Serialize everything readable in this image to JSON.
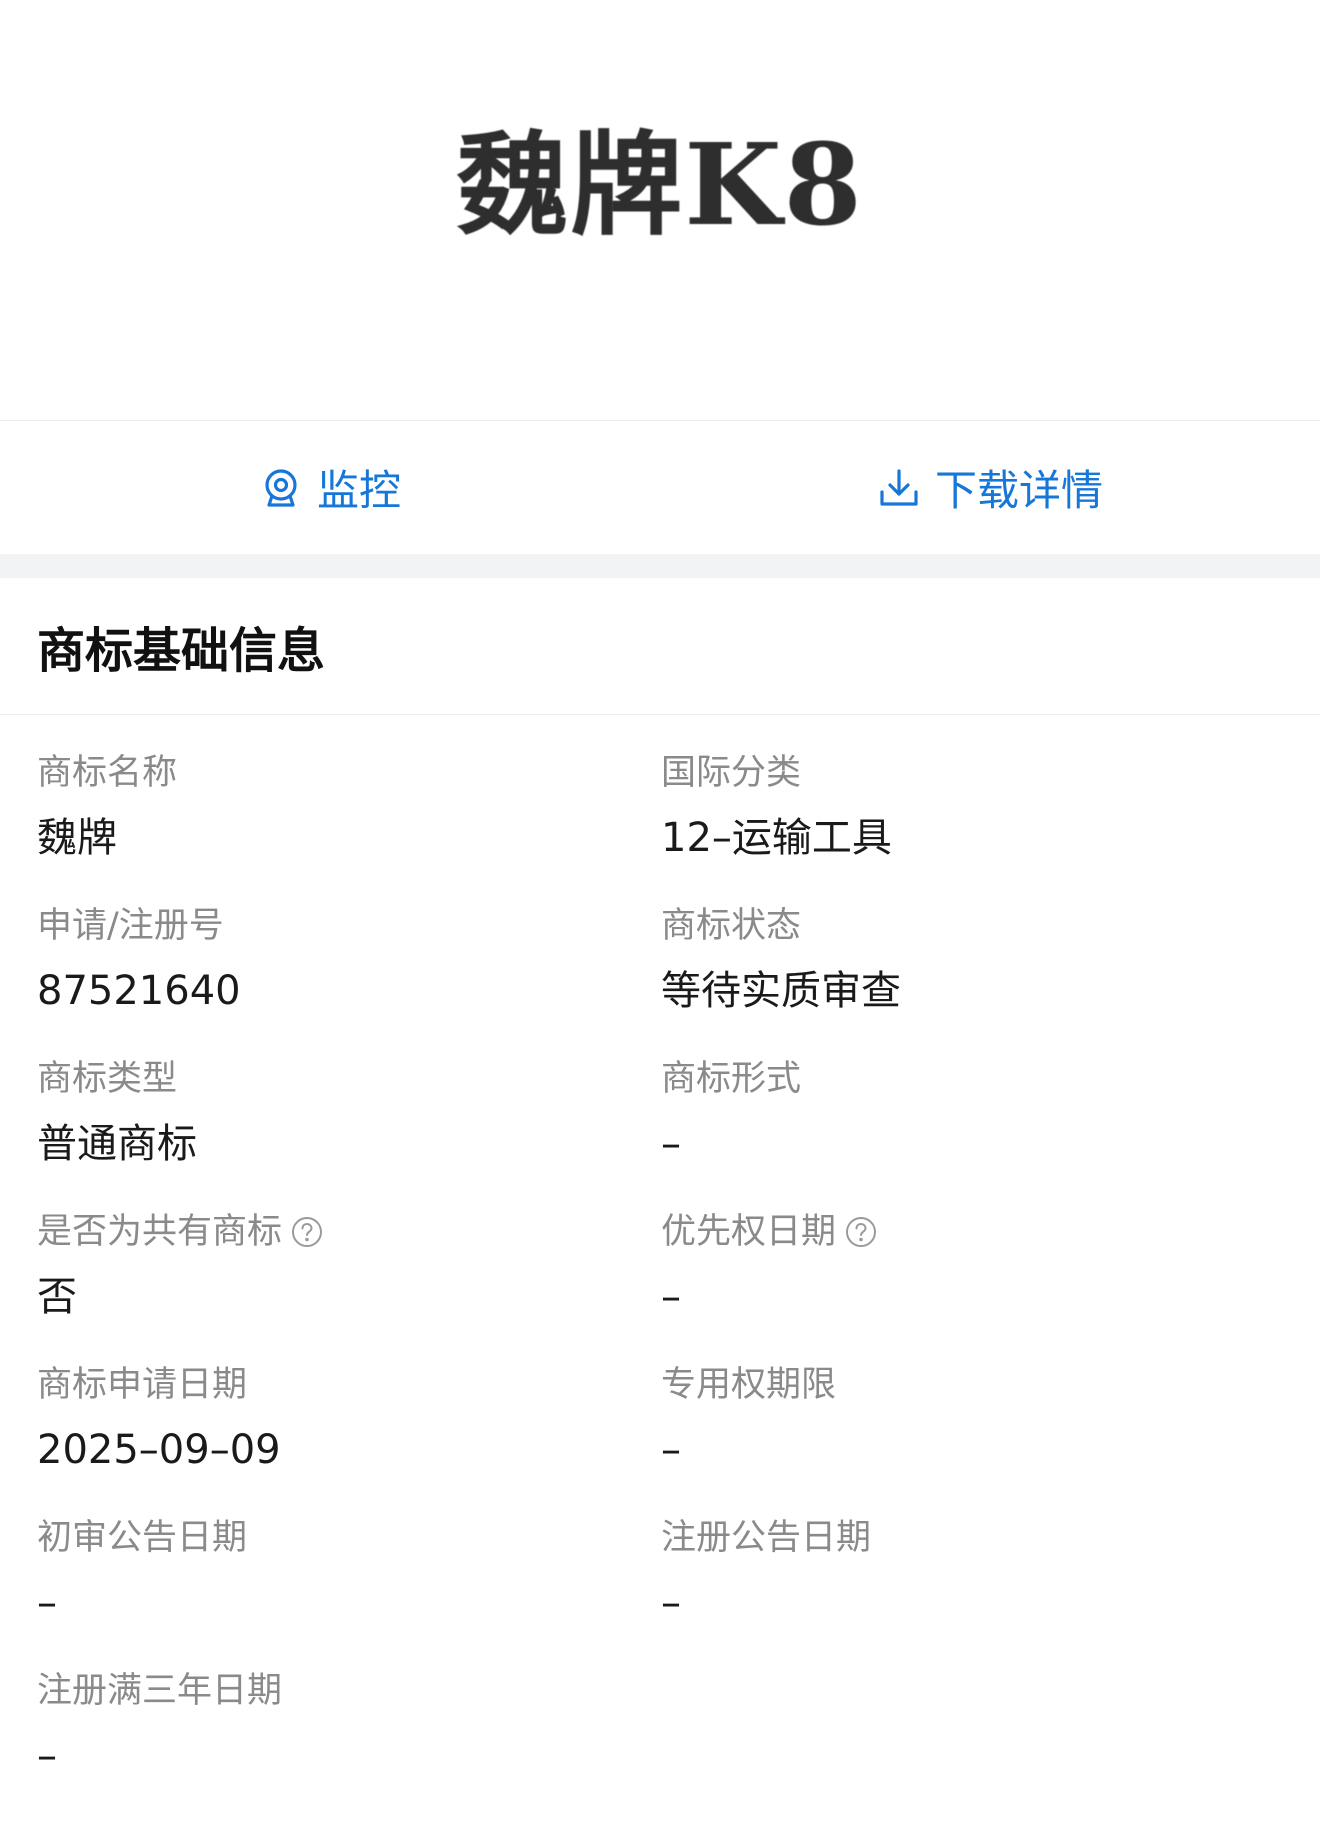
{
  "trademark_image": {
    "text": "魏牌K8"
  },
  "actions": {
    "monitor_label": "监控",
    "download_label": "下载详情"
  },
  "section": {
    "title": "商标基础信息"
  },
  "fields": {
    "name": {
      "label": "商标名称",
      "value": "魏牌"
    },
    "intl_class": {
      "label": "国际分类",
      "value": "12–运输工具"
    },
    "reg_no": {
      "label": "申请/注册号",
      "value": "87521640"
    },
    "status": {
      "label": "商标状态",
      "value": "等待实质审查"
    },
    "type": {
      "label": "商标类型",
      "value": "普通商标"
    },
    "form": {
      "label": "商标形式",
      "value": "–"
    },
    "shared": {
      "label": "是否为共有商标",
      "value": "否"
    },
    "priority_date": {
      "label": "优先权日期",
      "value": "–"
    },
    "apply_date": {
      "label": "商标申请日期",
      "value": "2025–09–09"
    },
    "exclusive_period": {
      "label": "专用权期限",
      "value": "–"
    },
    "prelim_date": {
      "label": "初审公告日期",
      "value": "–"
    },
    "reg_announce_date": {
      "label": "注册公告日期",
      "value": "–"
    },
    "three_year_date": {
      "label": "注册满三年日期",
      "value": "–"
    }
  },
  "colors": {
    "accent": "#1677d9",
    "label": "#8a8a8a",
    "value": "#1a1a1a",
    "divider": "#f1f3f5"
  },
  "icons": {
    "monitor": "monitor-icon",
    "download": "download-icon",
    "help": "help-icon"
  }
}
